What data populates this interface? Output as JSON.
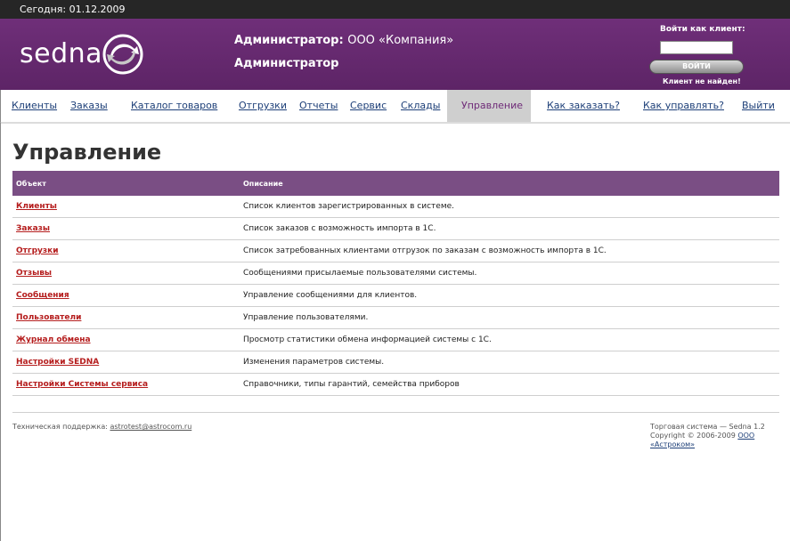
{
  "topbar": {
    "date_text": "Сегодня: 01.12.2009"
  },
  "header": {
    "logo_text": "sedna",
    "admin_label": "Администратор:",
    "org_name": "ООО «Компания»",
    "role": "Администратор",
    "login": {
      "label": "Войти как клиент:",
      "input_value": "",
      "button": "ВОЙТИ",
      "message": "Клиент не найден!"
    },
    "colors": {
      "header_bg": "#6f2f79",
      "active_tab_text": "#6e2a77"
    }
  },
  "nav": [
    {
      "label": "Клиенты"
    },
    {
      "label": "Заказы"
    },
    {
      "label": "Каталог товаров"
    },
    {
      "label": "Отгрузки"
    },
    {
      "label": "Отчеты"
    },
    {
      "label": "Сервис"
    },
    {
      "label": "Склады"
    },
    {
      "label": "Управление",
      "active": true
    },
    {
      "label": "Как заказать?"
    },
    {
      "label": "Как управлять?"
    },
    {
      "label": "Выйти"
    }
  ],
  "page": {
    "title": "Управление",
    "table": {
      "columns": [
        "Объект",
        "Описание"
      ],
      "rows": [
        {
          "object": "Клиенты",
          "description": "Список клиентов зарегистрированных в системе."
        },
        {
          "object": "Заказы",
          "description": "Список заказов с возможность импорта в 1С."
        },
        {
          "object": "Отгрузки",
          "description": "Список затребованных клиентами отгрузок по заказам с возможность импорта в 1С."
        },
        {
          "object": "Отзывы",
          "description": "Сообщениями присылаемые пользователями системы."
        },
        {
          "object": "Сообщения",
          "description": "Управление сообщениями для клиентов."
        },
        {
          "object": "Пользователи",
          "description": "Управление пользователями."
        },
        {
          "object": "Журнал обмена",
          "description": "Просмотр статистики обмена информацией системы с 1С."
        },
        {
          "object": "Настройки SEDNA",
          "description": "Изменения параметров системы."
        },
        {
          "object": "Настройки Системы сервиса",
          "description": "Справочники, типы гарантий, семейства приборов"
        }
      ]
    }
  },
  "footer": {
    "support_label": "Техническая поддержка:",
    "support_email": "astrotest@astrocom.ru",
    "system_name": "Торговая система — Sedna 1.2",
    "copyright": "Copyright © 2006-2009",
    "company_link": "ООО «Астроком»"
  }
}
